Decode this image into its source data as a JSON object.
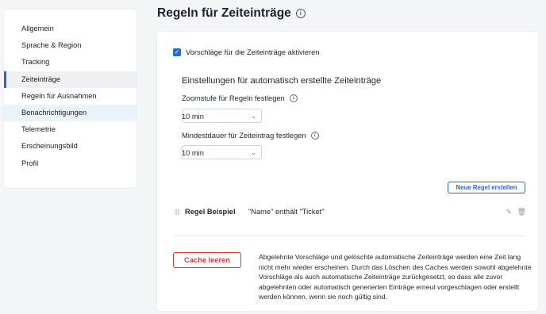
{
  "sidebar": {
    "items": [
      {
        "label": "Allgemein"
      },
      {
        "label": "Sprache & Region"
      },
      {
        "label": "Tracking"
      },
      {
        "label": "Zeiteinträge"
      },
      {
        "label": "Regeln für Ausnahmen"
      },
      {
        "label": "Benachrichtigungen"
      },
      {
        "label": "Telemetrie"
      },
      {
        "label": "Erscheinungsbild"
      },
      {
        "label": "Profil"
      }
    ],
    "active_index": 3,
    "hover_index": 5
  },
  "page": {
    "title": "Regeln für Zeiteinträge",
    "info_icon": "info-icon"
  },
  "settings": {
    "suggestions_checkbox_label": "Vorschläge für die Zeiteinträge aktivieren",
    "suggestions_checked": true,
    "section_title": "Einstellungen für automatisch erstellte Zeiteinträge",
    "zoom_label": "Zoomstufe für Regeln festlegen",
    "zoom_value": "10 min",
    "min_duration_label": "Mindestdauer für Zeiteintrag festlegen",
    "min_duration_value": "10 min"
  },
  "rules": {
    "new_rule_button": "Neue Regel erstellen",
    "items": [
      {
        "name": "Regel Beispiel",
        "condition": "\"Name\" enthält \"Ticket\""
      }
    ]
  },
  "cache": {
    "button_label": "Cache leeren",
    "description": "Abgelehnte Vorschläge und gelöschte automatische Zeiteinträge werden eine Zeit lang nicht mehr wieder erscheinen. Durch das Löschen des Caches werden sowohl abgelehnte Vorschläge als auch automatische Zeiteinträge zurückgesetzt, so dass alle zuvor abgelehnten oder automatisch generierten Einträge erneut vorgeschlagen oder erstellt werden können, wenn sie noch gültig sind."
  },
  "colors": {
    "accent": "#2a66d9",
    "danger": "#d43c3c",
    "background": "#f4f5f7"
  }
}
